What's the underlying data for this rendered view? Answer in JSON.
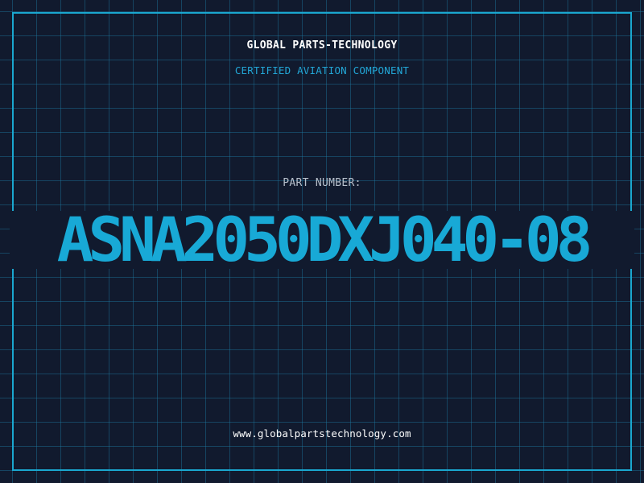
{
  "header": {
    "company": "GLOBAL PARTS-TECHNOLOGY",
    "subtitle": "CERTIFIED AVIATION COMPONENT"
  },
  "part": {
    "label": "PART NUMBER:",
    "number": "ASNA2050DXJ040-08"
  },
  "footer": {
    "url": "www.globalpartstechnology.com"
  },
  "colors": {
    "background": "#111a2e",
    "grid": "#1e78a0",
    "accent": "#18a9d6",
    "label": "#b7c0cc",
    "text": "#ffffff"
  }
}
